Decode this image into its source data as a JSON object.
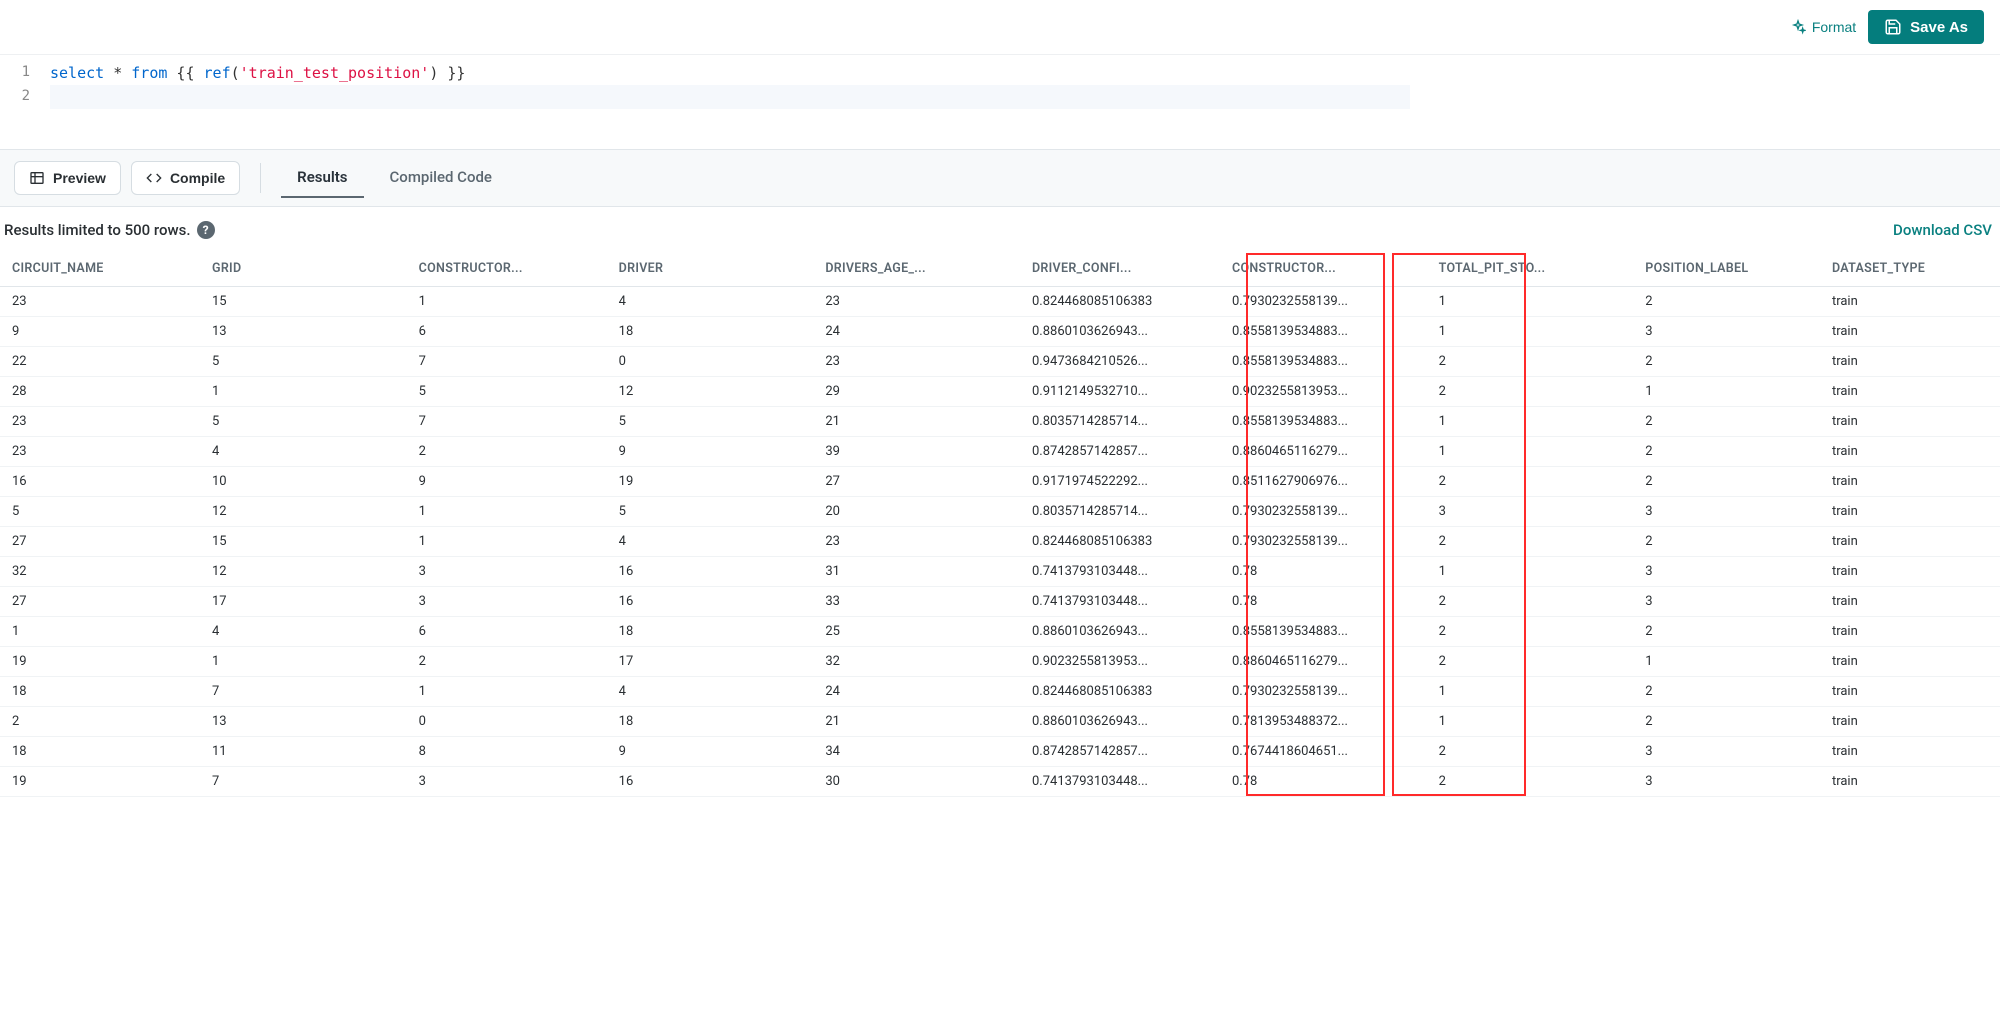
{
  "toolbar": {
    "format_label": "Format",
    "save_as_label": "Save As"
  },
  "editor": {
    "lines": [
      {
        "n": "1",
        "tokens": [
          [
            "kw",
            "select"
          ],
          [
            "",
            ""
          ],
          [
            "op",
            " * "
          ],
          [
            "kw",
            "from"
          ],
          [
            "",
            " {{ "
          ],
          [
            "fn",
            "ref"
          ],
          [
            "",
            "("
          ],
          [
            "str",
            "'train_test_position'"
          ],
          [
            "",
            ") }}"
          ]
        ]
      },
      {
        "n": "2",
        "tokens": []
      }
    ]
  },
  "panel": {
    "preview_label": "Preview",
    "compile_label": "Compile",
    "tabs": [
      "Results",
      "Compiled Code"
    ],
    "active_tab": 0
  },
  "results_info": {
    "text": "Results limited to 500 rows.",
    "download_label": "Download CSV"
  },
  "table": {
    "columns": [
      "CIRCUIT_NAME",
      "GRID",
      "CONSTRUCTOR...",
      "DRIVER",
      "DRIVERS_AGE_...",
      "DRIVER_CONFI...",
      "CONSTRUCTOR...",
      "TOTAL_PIT_STO...",
      "POSITION_LABEL",
      "DATASET_TYPE"
    ],
    "rows": [
      [
        "23",
        "15",
        "1",
        "4",
        "23",
        "0.824468085106383",
        "0.7930232558139...",
        "1",
        "2",
        "train"
      ],
      [
        "9",
        "13",
        "6",
        "18",
        "24",
        "0.8860103626943...",
        "0.8558139534883...",
        "1",
        "3",
        "train"
      ],
      [
        "22",
        "5",
        "7",
        "0",
        "23",
        "0.9473684210526...",
        "0.8558139534883...",
        "2",
        "2",
        "train"
      ],
      [
        "28",
        "1",
        "5",
        "12",
        "29",
        "0.9112149532710...",
        "0.9023255813953...",
        "2",
        "1",
        "train"
      ],
      [
        "23",
        "5",
        "7",
        "5",
        "21",
        "0.8035714285714...",
        "0.8558139534883...",
        "1",
        "2",
        "train"
      ],
      [
        "23",
        "4",
        "2",
        "9",
        "39",
        "0.8742857142857...",
        "0.8860465116279...",
        "1",
        "2",
        "train"
      ],
      [
        "16",
        "10",
        "9",
        "19",
        "27",
        "0.9171974522292...",
        "0.8511627906976...",
        "2",
        "2",
        "train"
      ],
      [
        "5",
        "12",
        "1",
        "5",
        "20",
        "0.8035714285714...",
        "0.7930232558139...",
        "3",
        "3",
        "train"
      ],
      [
        "27",
        "15",
        "1",
        "4",
        "23",
        "0.824468085106383",
        "0.7930232558139...",
        "2",
        "2",
        "train"
      ],
      [
        "32",
        "12",
        "3",
        "16",
        "31",
        "0.7413793103448...",
        "0.78",
        "1",
        "3",
        "train"
      ],
      [
        "27",
        "17",
        "3",
        "16",
        "33",
        "0.7413793103448...",
        "0.78",
        "2",
        "3",
        "train"
      ],
      [
        "1",
        "4",
        "6",
        "18",
        "25",
        "0.8860103626943...",
        "0.8558139534883...",
        "2",
        "2",
        "train"
      ],
      [
        "19",
        "1",
        "2",
        "17",
        "32",
        "0.9023255813953...",
        "0.8860465116279...",
        "2",
        "1",
        "train"
      ],
      [
        "18",
        "7",
        "1",
        "4",
        "24",
        "0.824468085106383",
        "0.7930232558139...",
        "1",
        "2",
        "train"
      ],
      [
        "2",
        "13",
        "0",
        "18",
        "21",
        "0.8860103626943...",
        "0.7813953488372...",
        "1",
        "2",
        "train"
      ],
      [
        "18",
        "11",
        "8",
        "9",
        "34",
        "0.8742857142857...",
        "0.7674418604651...",
        "2",
        "3",
        "train"
      ],
      [
        "19",
        "7",
        "3",
        "16",
        "30",
        "0.7413793103448...",
        "0.78",
        "2",
        "3",
        "train"
      ]
    ]
  }
}
